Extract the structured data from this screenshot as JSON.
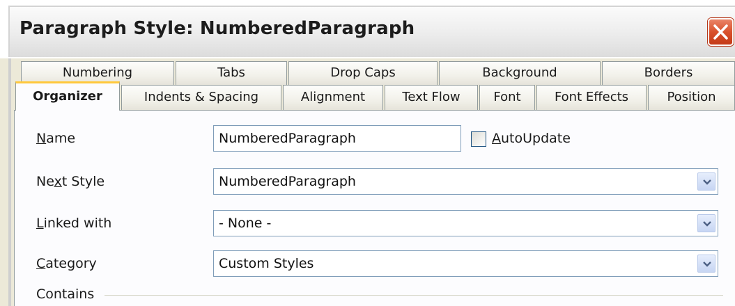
{
  "window": {
    "title": "Paragraph Style: NumberedParagraph"
  },
  "tabs": {
    "row1": [
      "Numbering",
      "Tabs",
      "Drop Caps",
      "Background",
      "Borders"
    ],
    "row2": [
      "Organizer",
      "Indents & Spacing",
      "Alignment",
      "Text Flow",
      "Font",
      "Font Effects",
      "Position"
    ],
    "active": "Organizer"
  },
  "form": {
    "name_label_u": "N",
    "name_label_rest": "ame",
    "name_value": "NumberedParagraph",
    "autoupdate_u": "A",
    "autoupdate_rest": "utoUpdate",
    "autoupdate_checked": false,
    "next_style_label_pre": "Ne",
    "next_style_label_u": "x",
    "next_style_label_rest": "t Style",
    "next_style_value": "NumberedParagraph",
    "linked_label_u": "L",
    "linked_label_rest": "inked with",
    "linked_value": "- None -",
    "category_label_u": "C",
    "category_label_rest": "ategory",
    "category_value": "Custom Styles",
    "contains_label": "Contains"
  },
  "colors": {
    "active_tab_accent": "#ffc83c",
    "close_button": "#d9512c",
    "field_border": "#7f9db9"
  },
  "icons": [
    "close-icon",
    "chevron-down-icon"
  ]
}
